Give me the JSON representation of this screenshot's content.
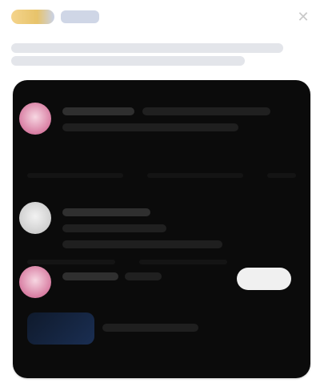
{
  "header": {
    "logo_icon": "brand-logo",
    "close_icon": "close-icon"
  },
  "headline": {
    "text": ""
  },
  "feed": {
    "items": [
      {
        "type": "post",
        "avatar": "avatar",
        "name": "",
        "handle": "",
        "timestamp": "",
        "text": ""
      },
      {
        "type": "post",
        "avatar": "avatar",
        "name": "",
        "handle": "",
        "timestamp": "",
        "text": ""
      },
      {
        "type": "post",
        "avatar": "avatar",
        "name": "",
        "handle": "",
        "timestamp": "",
        "text": "",
        "action_label": ""
      }
    ]
  },
  "colors": {
    "page_bg": "#ffffff",
    "card_bg": "#0b0b0b",
    "pill_bg": "#f0f0f0",
    "brand_gradient": [
      "#f4d48c",
      "#e7c36a",
      "#c9d2e8"
    ],
    "accent_blue": "#1a2e52",
    "avatar_pink": "#d87da2"
  }
}
